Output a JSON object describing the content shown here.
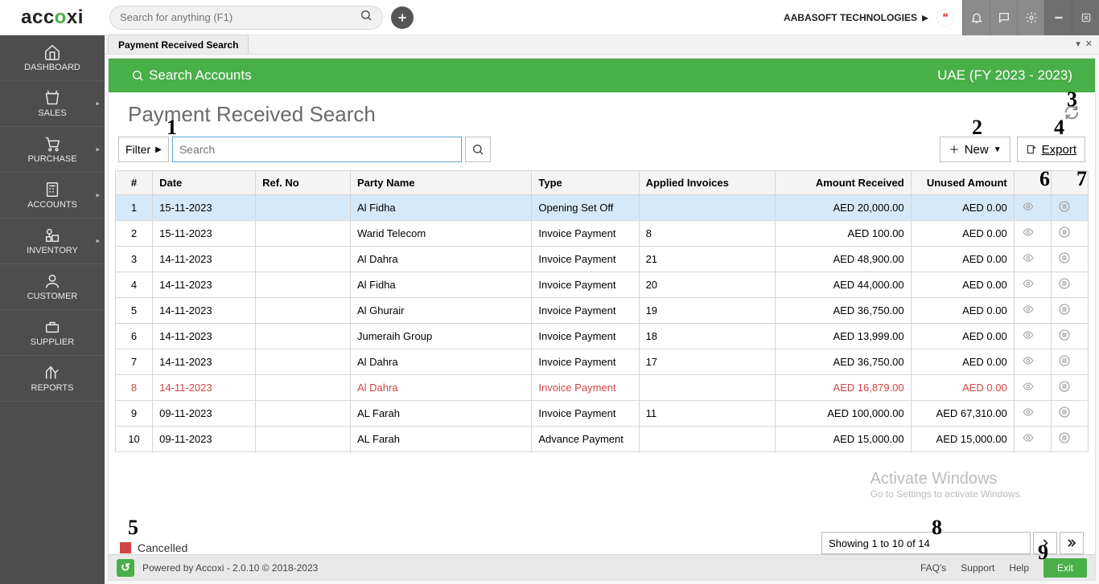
{
  "topbar": {
    "logo_text1": "acc",
    "logo_text2": "o",
    "logo_text3": "xi",
    "search_placeholder": "Search for anything (F1)",
    "company": "AABASOFT TECHNOLOGIES"
  },
  "nav": {
    "items": [
      {
        "label": "DASHBOARD"
      },
      {
        "label": "SALES"
      },
      {
        "label": "PURCHASE"
      },
      {
        "label": "ACCOUNTS"
      },
      {
        "label": "INVENTORY"
      },
      {
        "label": "CUSTOMER"
      },
      {
        "label": "SUPPLIER"
      },
      {
        "label": "REPORTS"
      }
    ]
  },
  "tab": {
    "label": "Payment Received Search"
  },
  "greenbar": {
    "left": "Search Accounts",
    "right": "UAE (FY 2023 - 2023)"
  },
  "page": {
    "title": "Payment Received Search"
  },
  "toolbar": {
    "filter_label": "Filter",
    "inline_search_placeholder": "Search",
    "new_label": "New",
    "export_label": "Export"
  },
  "annotations": {
    "a1": "1",
    "a2": "2",
    "a3": "3",
    "a4": "4",
    "a5": "5",
    "a6": "6",
    "a7": "7",
    "a8": "8",
    "a9": "9"
  },
  "columns": {
    "idx": "#",
    "date": "Date",
    "ref": "Ref. No",
    "party": "Party Name",
    "type": "Type",
    "applied": "Applied Invoices",
    "amount": "Amount Received",
    "unused": "Unused Amount"
  },
  "rows": [
    {
      "idx": "1",
      "date": "15-11-2023",
      "ref": "",
      "party": "Al Fidha",
      "type": "Opening Set Off",
      "applied": "",
      "amount": "AED 20,000.00",
      "unused": "AED 0.00",
      "selected": true
    },
    {
      "idx": "2",
      "date": "15-11-2023",
      "ref": "",
      "party": "Warid Telecom",
      "type": "Invoice Payment",
      "applied": "8",
      "amount": "AED 100.00",
      "unused": "AED 0.00"
    },
    {
      "idx": "3",
      "date": "14-11-2023",
      "ref": "",
      "party": "Al Dahra",
      "type": "Invoice Payment",
      "applied": "21",
      "amount": "AED 48,900.00",
      "unused": "AED 0.00"
    },
    {
      "idx": "4",
      "date": "14-11-2023",
      "ref": "",
      "party": "Al Fidha",
      "type": "Invoice Payment",
      "applied": "20",
      "amount": "AED 44,000.00",
      "unused": "AED 0.00"
    },
    {
      "idx": "5",
      "date": "14-11-2023",
      "ref": "",
      "party": "Al Ghurair",
      "type": "Invoice Payment",
      "applied": "19",
      "amount": "AED 36,750.00",
      "unused": "AED 0.00"
    },
    {
      "idx": "6",
      "date": "14-11-2023",
      "ref": "",
      "party": "Jumeraih Group",
      "type": "Invoice Payment",
      "applied": "18",
      "amount": "AED 13,999.00",
      "unused": "AED 0.00"
    },
    {
      "idx": "7",
      "date": "14-11-2023",
      "ref": "",
      "party": "Al Dahra",
      "type": "Invoice Payment",
      "applied": "17",
      "amount": "AED 36,750.00",
      "unused": "AED 0.00"
    },
    {
      "idx": "8",
      "date": "14-11-2023",
      "ref": "",
      "party": "Al Dahra",
      "type": "Invoice Payment",
      "applied": "",
      "amount": "AED 16,879.00",
      "unused": "AED 0.00",
      "cancelled": true
    },
    {
      "idx": "9",
      "date": "09-11-2023",
      "ref": "",
      "party": "AL Farah",
      "type": "Invoice Payment",
      "applied": "11",
      "amount": "AED 100,000.00",
      "unused": "AED 67,310.00"
    },
    {
      "idx": "10",
      "date": "09-11-2023",
      "ref": "",
      "party": "AL Farah",
      "type": "Advance Payment",
      "applied": "",
      "amount": "AED 15,000.00",
      "unused": "AED 15,000.00"
    }
  ],
  "legend": {
    "cancelled": "Cancelled"
  },
  "pager": {
    "text": "Showing 1 to 10 of 14"
  },
  "watermark": {
    "l1": "Activate Windows",
    "l2": "Go to Settings to activate Windows."
  },
  "footer": {
    "powered": "Powered by Accoxi - 2.0.10 © 2018-2023",
    "faqs": "FAQ's",
    "support": "Support",
    "help": "Help",
    "exit": "Exit"
  }
}
